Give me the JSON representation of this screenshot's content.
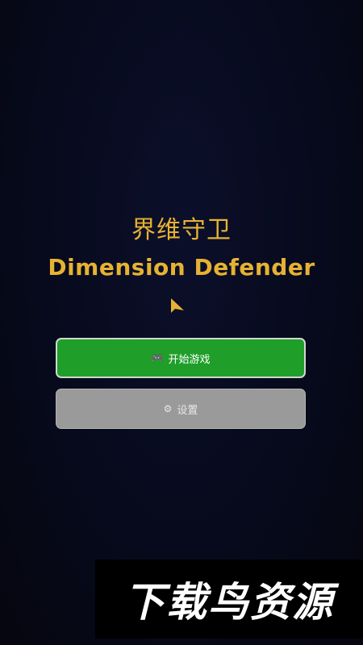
{
  "title": {
    "chinese": "界维守卫",
    "english": "Dimension Defender"
  },
  "menu": {
    "start_icon": "🎮",
    "start_label": "开始游戏",
    "settings_icon": "⚙",
    "settings_label": "设置"
  },
  "watermark": {
    "text": "下载鸟资源"
  },
  "icons": {
    "cursor": "arrow-cursor-icon",
    "start": "gamepad-icon",
    "settings": "gear-icon"
  },
  "colors": {
    "background": "#070a1c",
    "title": "#e7b233",
    "start_button": "#1f9e2a",
    "settings_button": "#9a9a9a",
    "cursor": "#e7b233"
  }
}
